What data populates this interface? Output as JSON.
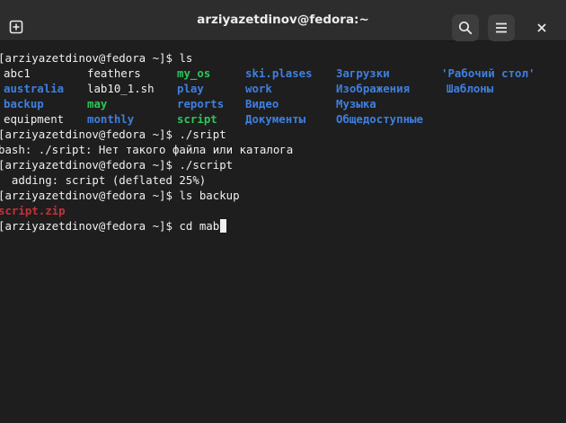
{
  "window": {
    "title": "arziyazetdinov@fedora:~"
  },
  "header": {
    "buttons": {
      "new_tab": {
        "icon": "new-tab-icon"
      },
      "search": {
        "icon": "search-icon"
      },
      "menu": {
        "icon": "hamburger-menu-icon"
      },
      "close": {
        "icon": "close-icon"
      }
    }
  },
  "terminal": {
    "colors": {
      "background": "#1e1e1e",
      "text": "#f0f0f0",
      "directory": "#3f7fe0",
      "executable": "#2ec45a",
      "archive": "#c83038"
    },
    "commands": [
      {
        "prompt": "[arziyazetdinov@fedora ~]$",
        "command": "ls"
      },
      {
        "prompt": "[arziyazetdinov@fedora ~]$",
        "command": "./sript"
      },
      {
        "prompt": "[arziyazetdinov@fedora ~]$",
        "command": "./script"
      },
      {
        "prompt": "[arziyazetdinov@fedora ~]$",
        "command": "ls backup"
      },
      {
        "prompt": "[arziyazetdinov@fedora ~]$",
        "command": "cd mab"
      }
    ],
    "ls_output": {
      "columns": [
        [
          {
            "name": "abc1",
            "kind": "file"
          },
          {
            "name": "australia",
            "kind": "dir"
          },
          {
            "name": "backup",
            "kind": "dir"
          },
          {
            "name": "equipment",
            "kind": "file"
          }
        ],
        [
          {
            "name": "feathers",
            "kind": "file"
          },
          {
            "name": "lab10_1.sh",
            "kind": "file"
          },
          {
            "name": "may",
            "kind": "exec"
          },
          {
            "name": "monthly",
            "kind": "dir"
          }
        ],
        [
          {
            "name": "my_os",
            "kind": "exec"
          },
          {
            "name": "play",
            "kind": "dir"
          },
          {
            "name": "reports",
            "kind": "dir"
          },
          {
            "name": "script",
            "kind": "exec"
          }
        ],
        [
          {
            "name": "ski.plases",
            "kind": "dir"
          },
          {
            "name": "work",
            "kind": "dir"
          },
          {
            "name": "Видео",
            "kind": "dir"
          },
          {
            "name": "Документы",
            "kind": "dir"
          }
        ],
        [
          {
            "name": "Загрузки",
            "kind": "dir"
          },
          {
            "name": "Изображения",
            "kind": "dir"
          },
          {
            "name": "Музыка",
            "kind": "dir"
          },
          {
            "name": "Общедоступные",
            "kind": "dir"
          }
        ],
        [
          {
            "name": "'Рабочий стол'",
            "kind": "dir"
          },
          {
            "name": "Шаблоны",
            "kind": "dir"
          },
          {
            "name": "",
            "kind": "dir"
          },
          {
            "name": "",
            "kind": "dir"
          }
        ]
      ]
    },
    "sript_error": "bash: ./sript: Нет такого файла или каталога",
    "script_output": "  adding: script (deflated 25%)",
    "backup_listing": "script.zip"
  }
}
